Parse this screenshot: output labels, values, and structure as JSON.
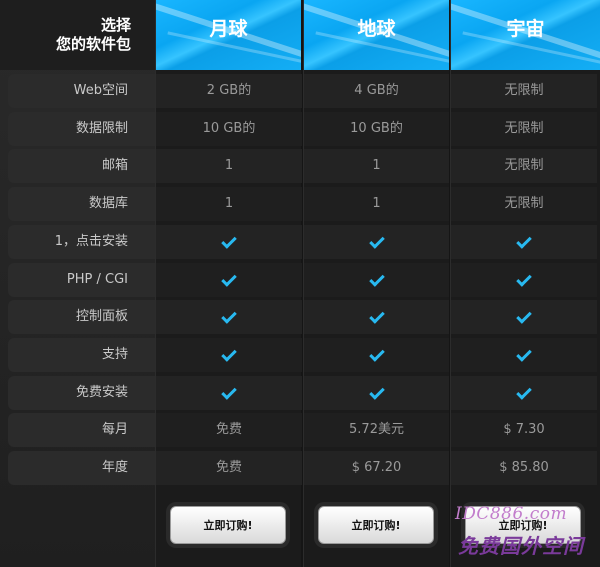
{
  "header": {
    "corner_line1": "选择",
    "corner_line2": "您的软件包",
    "plans": [
      "月球",
      "地球",
      "宇宙"
    ]
  },
  "rows": [
    {
      "label": "Web空间",
      "values": [
        "2 GB的",
        "4 GB的",
        "无限制"
      ]
    },
    {
      "label": "数据限制",
      "values": [
        "10 GB的",
        "10 GB的",
        "无限制"
      ]
    },
    {
      "label": "邮箱",
      "values": [
        "1",
        "1",
        "无限制"
      ]
    },
    {
      "label": "数据库",
      "values": [
        "1",
        "1",
        "无限制"
      ]
    },
    {
      "label": "1，点击安装",
      "values": [
        "check",
        "check",
        "check"
      ]
    },
    {
      "label": "PHP / CGI",
      "values": [
        "check",
        "check",
        "check"
      ]
    },
    {
      "label": "控制面板",
      "values": [
        "check",
        "check",
        "check"
      ]
    },
    {
      "label": "支持",
      "values": [
        "check",
        "check",
        "check"
      ]
    },
    {
      "label": "免费安装",
      "values": [
        "check",
        "check",
        "check"
      ]
    },
    {
      "label": "每月",
      "values": [
        "免费",
        "5.72美元",
        "$ 7.30"
      ]
    },
    {
      "label": "年度",
      "values": [
        "免费",
        "$ 67.20",
        "$ 85.80"
      ]
    }
  ],
  "footer": {
    "order_label": "立即订购!",
    "watermark_line1": "IDC886.com",
    "watermark_line2": "免费国外空间"
  },
  "colors": {
    "accent": "#28b9f0",
    "header_blue": "#14aef5"
  },
  "icons": {
    "check": "checkmark-icon"
  }
}
